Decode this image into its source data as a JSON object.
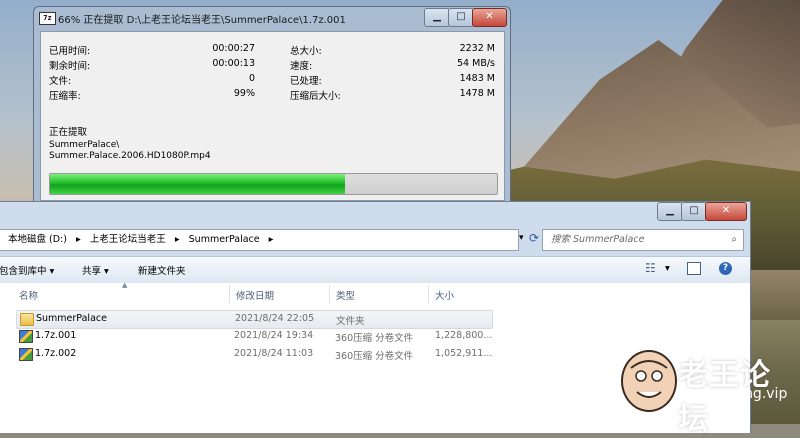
{
  "progress_window": {
    "app_icon_text": "7z",
    "title": "66% 正在提取 D:\\上老王论坛当老王\\SummerPalace\\1.7z.001",
    "minimize": "▁",
    "maximize": "□",
    "close": "✕",
    "stats_left": [
      {
        "label": "已用时间:",
        "value": "00:00:27"
      },
      {
        "label": "剩余时间:",
        "value": "00:00:13"
      },
      {
        "label": "文件:",
        "value": "0"
      },
      {
        "label": "压缩率:",
        "value": "99%"
      }
    ],
    "stats_right": [
      {
        "label": "总大小:",
        "value": "2232 M"
      },
      {
        "label": "速度:",
        "value": "54 MB/s"
      },
      {
        "label": "已处理:",
        "value": "1483 M"
      },
      {
        "label": "压缩后大小:",
        "value": "1478 M"
      }
    ],
    "status": "正在提取",
    "current_path_line1": "SummerPalace\\",
    "current_path_line2": "Summer.Palace.2006.HD1080P.mp4",
    "progress": 0.66
  },
  "explorer": {
    "minimize": "▁",
    "maximize": "□",
    "close": "✕",
    "breadcrumb": [
      "本地磁盘 (D:)",
      "▸",
      "上老王论坛当老王",
      "▸",
      "SummerPalace",
      "▸"
    ],
    "search_placeholder": "搜索 SummerPalace",
    "toolbar": {
      "include_library": "包含到库中",
      "share": "共享",
      "new_folder": "新建文件夹"
    },
    "columns": [
      "名称",
      "修改日期",
      "类型",
      "大小"
    ],
    "rows": [
      {
        "name": "SummerPalace",
        "date": "2021/8/24 22:05",
        "type": "文件夹",
        "size": ""
      },
      {
        "name": "1.7z.001",
        "date": "2021/8/24 19:34",
        "type": "360压缩 分卷文件",
        "size": "1,228,800..."
      },
      {
        "name": "1.7z.002",
        "date": "2021/8/24 11:03",
        "type": "360压缩 分卷文件",
        "size": "1,052,911..."
      }
    ]
  },
  "watermark": {
    "text": "老王论坛",
    "url": "laowang.vip"
  }
}
